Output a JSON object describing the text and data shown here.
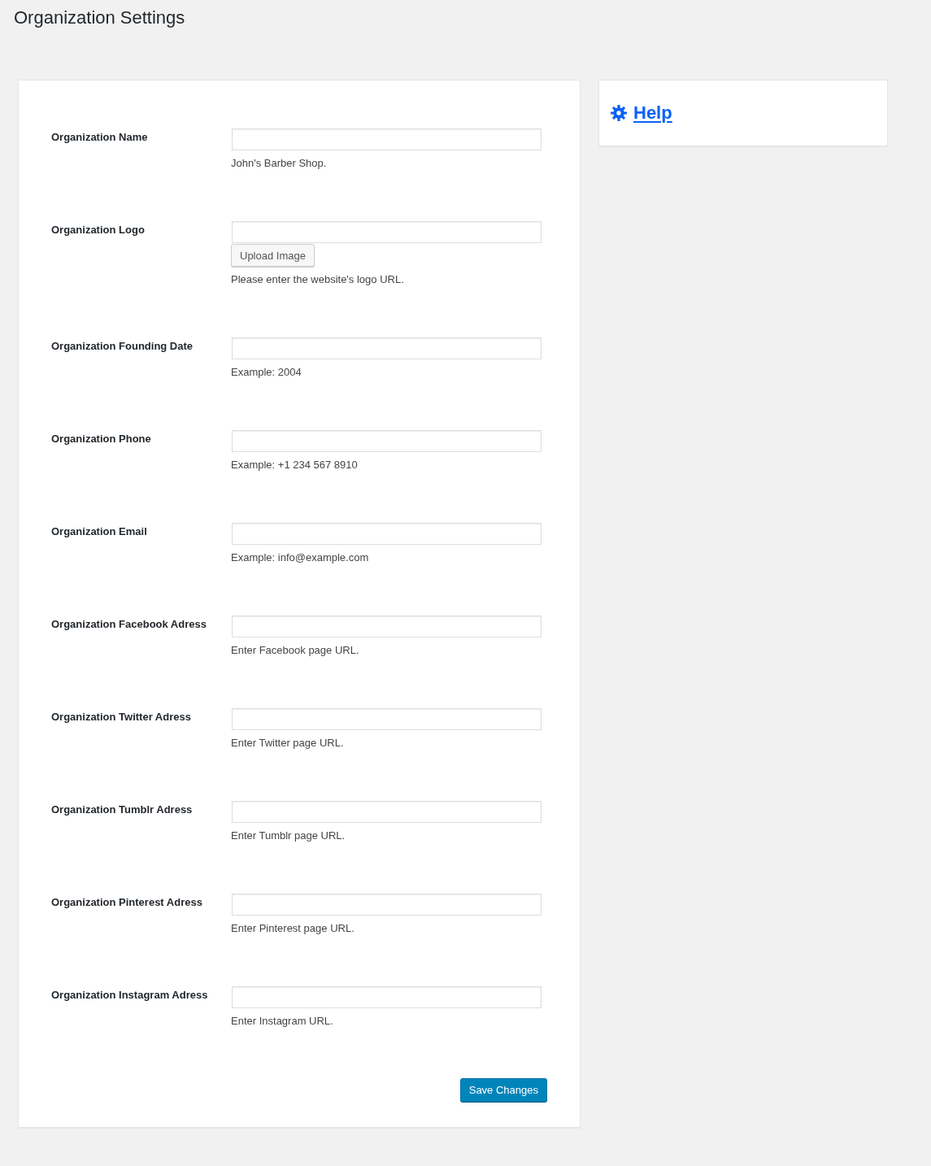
{
  "page": {
    "title": "Organization Settings"
  },
  "settings": [
    {
      "kind": "text",
      "label": "Organization Name",
      "description": "John's Barber Shop."
    },
    {
      "kind": "image",
      "label": "Organization Logo",
      "button": "Upload Image",
      "description": "Please enter the website's logo URL."
    },
    {
      "kind": "text",
      "label": "Organization Founding Date",
      "description": "Example: 2004"
    },
    {
      "kind": "text",
      "label": "Organization Phone",
      "description": "Example: +1 234 567 8910"
    },
    {
      "kind": "text",
      "label": "Organization Email",
      "description": "Example: info@example.com"
    },
    {
      "kind": "text",
      "label": "Organization Facebook Adress",
      "description": "Enter Facebook page URL."
    },
    {
      "kind": "text",
      "label": "Organization Twitter Adress",
      "description": "Enter Twitter page URL."
    },
    {
      "kind": "text",
      "label": "Organization Tumblr Adress",
      "description": "Enter Tumblr page URL."
    },
    {
      "kind": "text",
      "label": "Organization Pinterest Adress",
      "description": "Enter Pinterest page URL."
    },
    {
      "kind": "text",
      "label": "Organization Instagram Adress",
      "description": "Enter Instagram URL."
    }
  ],
  "save_button": "Save Changes",
  "help": {
    "link": "Help"
  }
}
